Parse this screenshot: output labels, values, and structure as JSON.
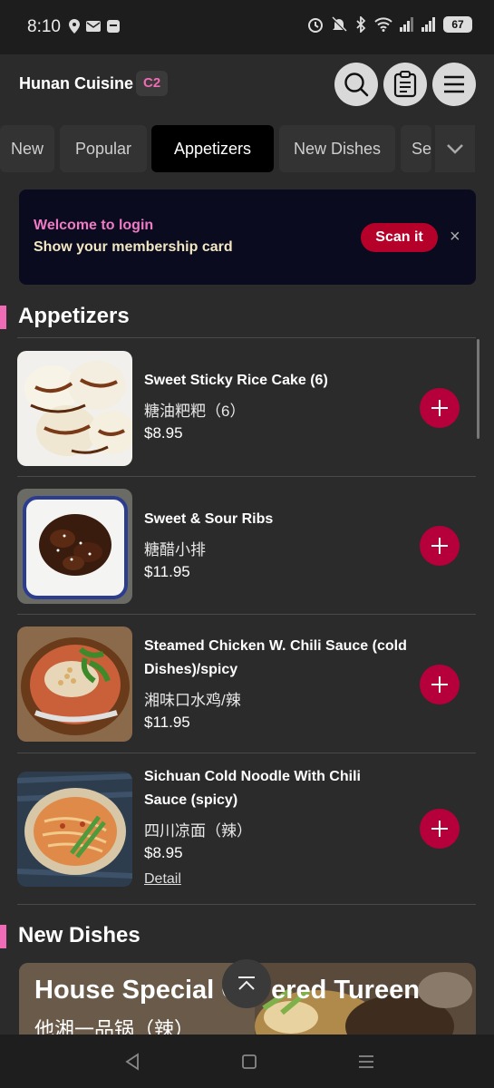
{
  "status_bar": {
    "time": "8:10",
    "battery": "67",
    "left_icons": [
      "location-icon",
      "mail-icon",
      "message-icon"
    ],
    "right_icons": [
      "alarm-icon",
      "mute-icon",
      "bluetooth-icon",
      "wifi-icon",
      "signal-icon",
      "signal-icon"
    ]
  },
  "header": {
    "restaurant_name": "Hunan Cuisine",
    "table_badge": "C2",
    "buttons": [
      "search-icon",
      "clipboard-icon",
      "hamburger-menu-icon"
    ]
  },
  "tabs": [
    {
      "label": "New",
      "active": false
    },
    {
      "label": "Popular",
      "active": false
    },
    {
      "label": "Appetizers",
      "active": true
    },
    {
      "label": "New Dishes",
      "active": false
    },
    {
      "label": "Se",
      "active": false
    }
  ],
  "banner": {
    "line1": "Welcome to login",
    "line2": "Show your membership card",
    "scan_label": "Scan it",
    "close_label": "×"
  },
  "sections": {
    "appetizers": "Appetizers",
    "new_dishes": "New Dishes"
  },
  "items": [
    {
      "name": "Sweet Sticky Rice Cake (6)",
      "cn": "糖油粑粑（6）",
      "price": "$8.95"
    },
    {
      "name": "Sweet & Sour Ribs",
      "cn": "糖醋小排",
      "price": "$11.95"
    },
    {
      "name": "Steamed Chicken W. Chili Sauce (cold Dishes)/spicy",
      "cn": "湘味口水鸡/辣",
      "price": "$11.95"
    },
    {
      "name": "Sichuan Cold Noodle With Chili Sauce (spicy)",
      "cn": "四川凉面（辣）",
      "price": "$8.95",
      "detail": "Detail"
    }
  ],
  "featured": {
    "title": "House Special Covered Tureen",
    "cn": "他湘一品锅（辣）"
  },
  "colors": {
    "accent_pink": "#f06bb5",
    "add_button": "#b5003b",
    "scan_button": "#b5002a",
    "background": "#2b2b2b"
  }
}
